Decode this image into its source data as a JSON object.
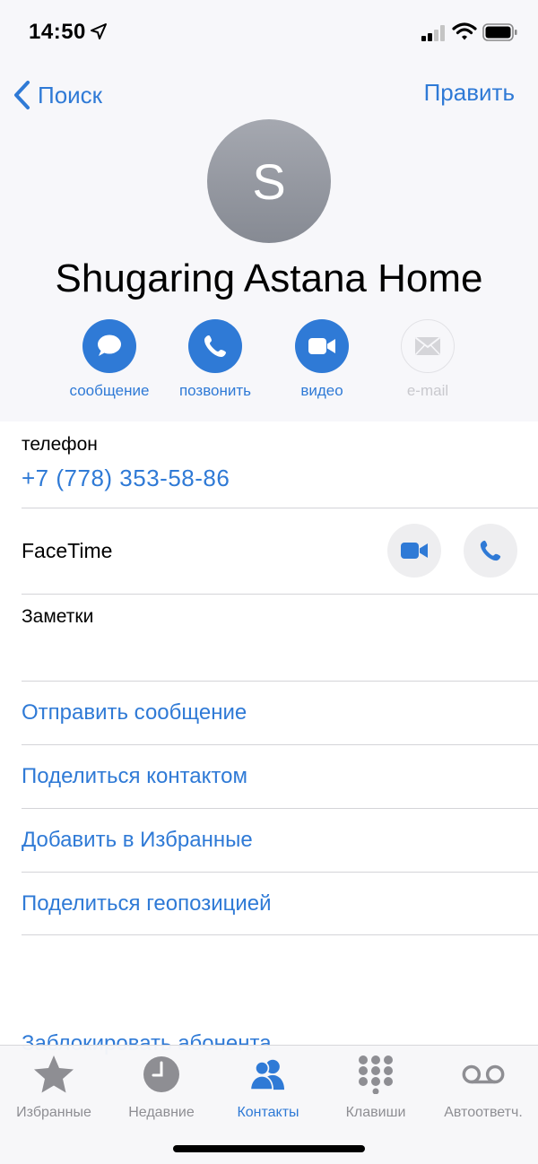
{
  "status_bar": {
    "time": "14:50"
  },
  "nav": {
    "back_label": "Поиск",
    "edit_label": "Править"
  },
  "contact": {
    "initial": "S",
    "name": "Shugaring Astana Home"
  },
  "actions": [
    {
      "label": "сообщение",
      "icon": "message-icon",
      "enabled": true
    },
    {
      "label": "позвонить",
      "icon": "phone-icon",
      "enabled": true
    },
    {
      "label": "видео",
      "icon": "video-icon",
      "enabled": true
    },
    {
      "label": "e-mail",
      "icon": "mail-icon",
      "enabled": false
    }
  ],
  "phone": {
    "caption": "телефон",
    "number": "+7 (778) 353-58-86"
  },
  "facetime": {
    "title": "FaceTime"
  },
  "notes": {
    "caption": "Заметки"
  },
  "links": [
    "Отправить сообщение",
    "Поделиться контактом",
    "Добавить в Избранные",
    "Поделиться геопозицией"
  ],
  "block_label": "Заблокировать абонента",
  "tabbar": {
    "active": "Контакты",
    "tabs": [
      {
        "label": "Избранные",
        "icon": "star-icon"
      },
      {
        "label": "Недавние",
        "icon": "clock-icon"
      },
      {
        "label": "Контакты",
        "icon": "contacts-icon"
      },
      {
        "label": "Клавиши",
        "icon": "keypad-icon"
      },
      {
        "label": "Автоответч.",
        "icon": "voicemail-icon"
      }
    ]
  },
  "colors": {
    "accent": "#2f7ad6",
    "inactive": "#8e8e93"
  }
}
